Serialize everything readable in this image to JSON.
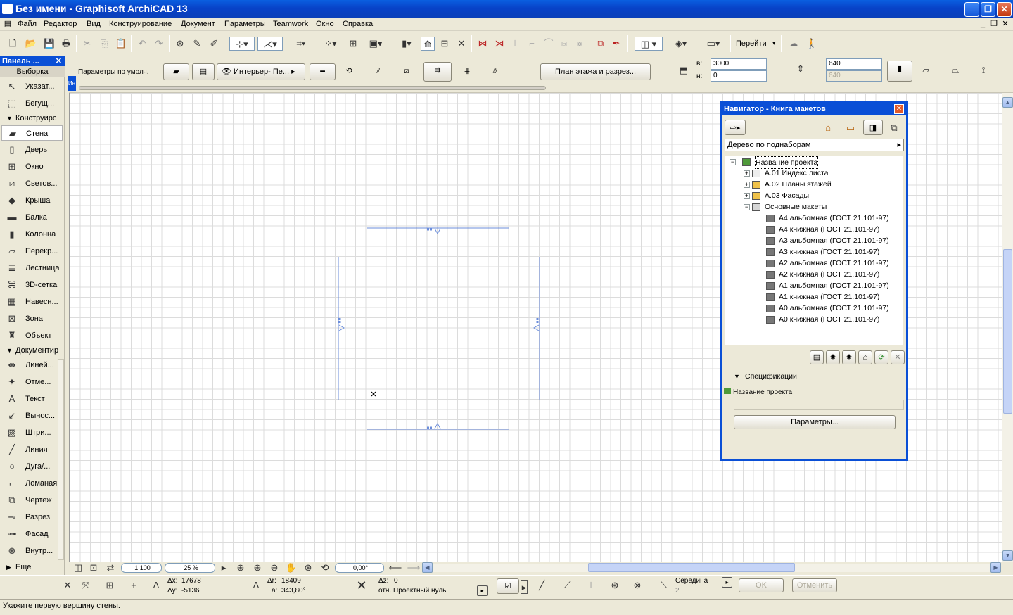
{
  "window": {
    "title": "Без имени - Graphisoft ArchiCAD 13"
  },
  "menu": [
    "Файл",
    "Редактор",
    "Вид",
    "Конструирование",
    "Документ",
    "Параметры",
    "Teamwork",
    "Окно",
    "Справка"
  ],
  "toolbar": {
    "goto_label": "Перейти"
  },
  "infobox": {
    "default_label": "Параметры по умолч.",
    "view_mode": "Интерьер- Пе...",
    "floor_plan_btn": "План этажа и разрез...",
    "top_label": "в:",
    "bottom_label": "н:",
    "top_value": "3000",
    "bottom_value": "0",
    "thickness_value": "640",
    "thickness2_value": "640"
  },
  "toolbox": {
    "title": "Панель ...",
    "select_header": "Выборка",
    "select_items": [
      "Указат...",
      "Бегущ..."
    ],
    "construct_header": "Конструирс",
    "construct_items": [
      "Стена",
      "Дверь",
      "Окно",
      "Светов...",
      "Крыша",
      "Балка",
      "Колонна",
      "Перекр...",
      "Лестница",
      "3D-сетка",
      "Навесн...",
      "Зона",
      "Объект"
    ],
    "doc_header": "Документир",
    "doc_items": [
      "Линей...",
      "Отме...",
      "Текст",
      "Вынос...",
      "Штри...",
      "Линия",
      "Дуга/...",
      "Ломаная",
      "Чертеж",
      "Разрез",
      "Фасад",
      "Внутр..."
    ],
    "more": "Еще"
  },
  "navigator": {
    "title": "Навигатор - Книга макетов",
    "view_dropdown": "Дерево по поднаборам",
    "root": "Название проекта",
    "groups": [
      "А.01  Индекс листа",
      "А.02 Планы этажей",
      "А.03 Фасады",
      "Основные макеты"
    ],
    "layouts": [
      "А4 альбомная (ГОСТ 21.101-97)",
      "А4 книжная (ГОСТ 21.101-97)",
      "А3 альбомная (ГОСТ 21.101-97)",
      "А3 книжная (ГОСТ 21.101-97)",
      "А2 альбомная (ГОСТ 21.101-97)",
      "А2 книжная (ГОСТ 21.101-97)",
      "А1 альбомная (ГОСТ 21.101-97)",
      "А1 книжная (ГОСТ 21.101-97)",
      "А0 альбомная (ГОСТ 21.101-97)",
      "А0 книжная (ГОСТ 21.101-97)"
    ],
    "spec_header": "Спецификации",
    "spec_project": "Название проекта",
    "params_btn": "Параметры..."
  },
  "viewbar": {
    "scale": "1:100",
    "zoom": "25 %",
    "angle": "0,00°"
  },
  "coords": {
    "dx_label": "Δx:",
    "dx": "17678",
    "dy_label": "Δy:",
    "dy": "-5136",
    "dr_label": "Δr:",
    "dr": "18409",
    "a_label": "a:",
    "a": "343,80°",
    "dz_label": "Δz:",
    "dz": "0",
    "ref": "отн. Проектный нуль",
    "snap": "Середина",
    "snap_n": "2",
    "ok": "OK",
    "cancel": "Отменить"
  },
  "status": {
    "message": "Укажите первую вершину стены."
  }
}
